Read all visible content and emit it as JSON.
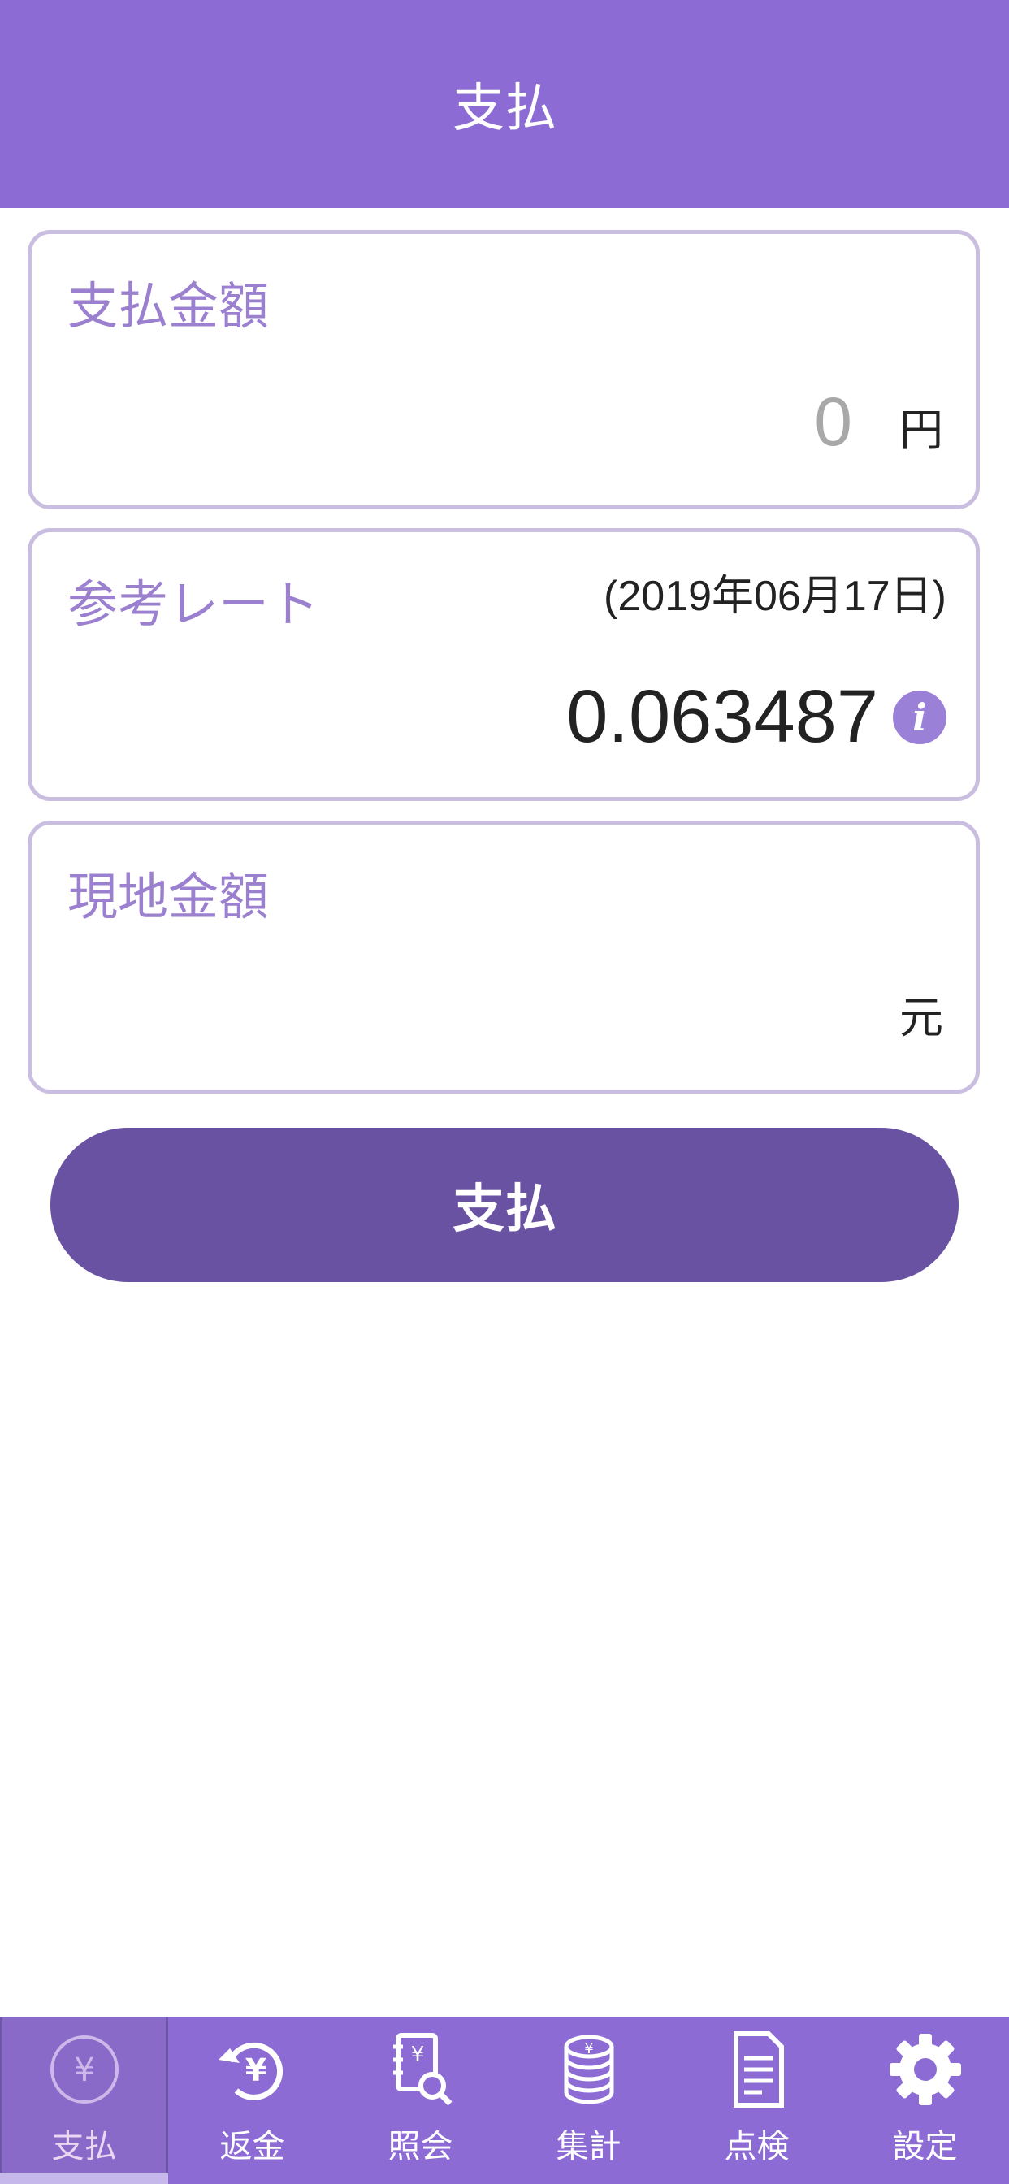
{
  "header": {
    "title": "支払"
  },
  "payment_amount": {
    "label": "支払金額",
    "value": "0",
    "unit": "円"
  },
  "reference_rate": {
    "label": "参考レート",
    "date": "(2019年06月17日)",
    "value": "0.063487",
    "info_icon": "info-icon"
  },
  "local_amount": {
    "label": "現地金額",
    "value": "",
    "unit": "元"
  },
  "pay_button": {
    "label": "支払"
  },
  "tabbar": {
    "tabs": [
      {
        "label": "支払",
        "icon": "yen-circle-icon",
        "active": true
      },
      {
        "label": "返金",
        "icon": "refund-yen-icon",
        "active": false
      },
      {
        "label": "照会",
        "icon": "inquiry-ledger-icon",
        "active": false
      },
      {
        "label": "集計",
        "icon": "coin-stack-icon",
        "active": false
      },
      {
        "label": "点検",
        "icon": "document-check-icon",
        "active": false
      },
      {
        "label": "設定",
        "icon": "gear-icon",
        "active": false
      }
    ]
  },
  "colors": {
    "header": "#8c6cd4",
    "button": "#6a52a3",
    "label": "#9b80cf",
    "card_border": "#c9bde0"
  }
}
